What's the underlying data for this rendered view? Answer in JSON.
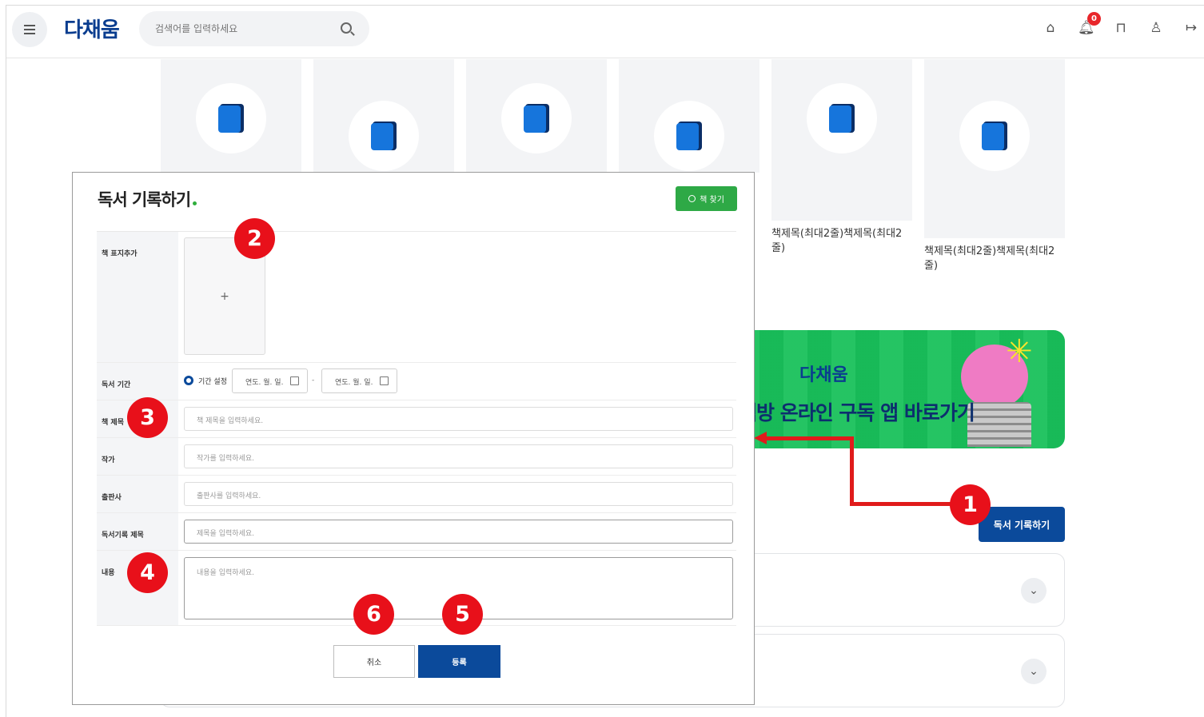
{
  "header": {
    "logo": "다채움",
    "search_placeholder": "검색어를 입력하세요",
    "notification_count": "0",
    "icons": [
      "home-icon",
      "bell-icon",
      "bookmark-icon",
      "user-icon",
      "logout-icon"
    ]
  },
  "books": [
    {
      "title": ""
    },
    {
      "title": ""
    },
    {
      "title": ""
    },
    {
      "title": ""
    },
    {
      "title": "책제목(최대2줄)책제목(최대2줄)"
    },
    {
      "title": "책제목(최대2줄)책제목(최대2줄)"
    }
  ],
  "banner": {
    "logo": "다채움",
    "text": "책방 온라인 구독 앱 바로가기"
  },
  "main_record_button": "독서 기록하기",
  "modal": {
    "title": "독서 기록하기",
    "find_book_button": "책 찾기",
    "fields": {
      "cover_label": "책 표지추가",
      "cover_add": "+",
      "period_label": "독서 기간",
      "period_option": "기간 설정",
      "date_start_placeholder": "연도. 월. 일.",
      "date_separator": "-",
      "date_end_placeholder": "연도. 월. 일.",
      "title_label": "책 제목",
      "title_placeholder": "책 제목을 입력하세요.",
      "author_label": "작가",
      "author_placeholder": "작가를 입력하세요.",
      "publisher_label": "출판사",
      "publisher_placeholder": "출판사를 입력하세요.",
      "record_title_label": "독서기록 제목",
      "record_title_placeholder": "제목을 입력하세요.",
      "content_label": "내용",
      "content_placeholder": "내용을 입력하세요."
    },
    "cancel_button": "취소",
    "submit_button": "등록"
  },
  "steps": [
    "1",
    "2",
    "3",
    "4",
    "5",
    "6"
  ],
  "colors": {
    "primary": "#0b4a9b",
    "accent_green": "#2ea946",
    "marker_red": "#e8101a",
    "banner_green": "#19c15b"
  }
}
